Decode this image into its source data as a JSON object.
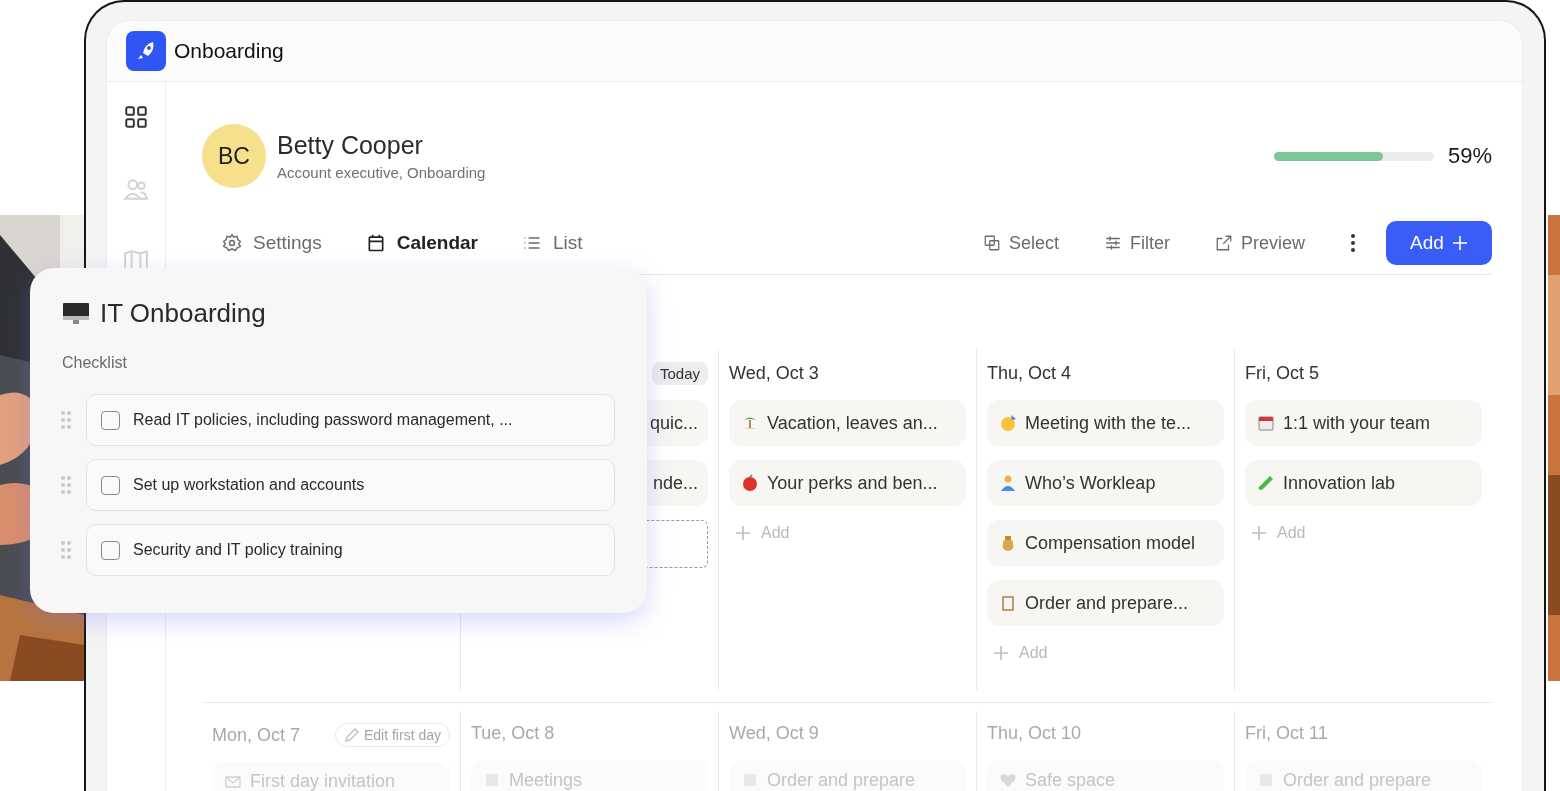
{
  "app": {
    "title": "Onboarding"
  },
  "sidebar": {
    "items": [
      {
        "kind": "grid",
        "selected": true
      },
      {
        "kind": "people",
        "selected": false
      },
      {
        "kind": "map",
        "selected": false
      }
    ]
  },
  "profile": {
    "initials": "BC",
    "name": "Betty Cooper",
    "subtitle": "Account executive, Onboarding",
    "progress": {
      "level": 0.68,
      "reading": "59%"
    }
  },
  "tabs": [
    {
      "label": "Settings",
      "kind": "settings",
      "selected": false
    },
    {
      "label": "Calendar",
      "kind": "calendar",
      "selected": true
    },
    {
      "label": "List",
      "kind": "list",
      "selected": false
    }
  ],
  "actions": [
    {
      "label": "Select",
      "kind": "select"
    },
    {
      "label": "Filter",
      "kind": "filter"
    },
    {
      "label": "Preview",
      "kind": "preview"
    }
  ],
  "add_button": {
    "label": "Add"
  },
  "week_1": {
    "days": [
      {
        "badge": "Today",
        "cards": [
          {
            "title": "quic..."
          },
          {
            "title": "nde..."
          }
        ],
        "drop_slot": true
      },
      {
        "label": "Wed, Oct 3",
        "cards": [
          {
            "kind": "palm",
            "title": "Vacation, leaves an..."
          },
          {
            "kind": "apple",
            "title": "Your perks and ben..."
          }
        ],
        "add_label": "Add"
      },
      {
        "label": "Thu, Oct 4",
        "cards": [
          {
            "kind": "party",
            "title": "Meeting with the te..."
          },
          {
            "kind": "person",
            "title": "Who’s Workleap"
          },
          {
            "kind": "money",
            "title": "Compensation model"
          },
          {
            "kind": "clipboard",
            "title": "Order and prepare..."
          }
        ],
        "add_label": "Add"
      },
      {
        "label": "Fri, Oct 5",
        "cards": [
          {
            "kind": "calendar",
            "title": "1:1 with your team"
          },
          {
            "kind": "tube",
            "title": "Innovation lab"
          }
        ],
        "add_label": "Add"
      }
    ]
  },
  "week_2": {
    "days": [
      {
        "label": "Mon, Oct 7",
        "chip": "Edit first day",
        "cards": [
          {
            "kind": "mail",
            "title": "First day invitation"
          }
        ]
      },
      {
        "label": "Tue, Oct 8",
        "cards": [
          {
            "kind": "note",
            "title": "Meetings"
          }
        ]
      },
      {
        "label": "Wed, Oct 9",
        "cards": [
          {
            "kind": "note",
            "title": "Order and prepare"
          }
        ]
      },
      {
        "label": "Thu, Oct 10",
        "cards": [
          {
            "kind": "heart",
            "title": "Safe space"
          }
        ]
      },
      {
        "label": "Fri, Oct 11",
        "cards": [
          {
            "kind": "note",
            "title": "Order and prepare"
          }
        ]
      }
    ]
  },
  "overlay": {
    "title": "IT Onboarding",
    "section": "Checklist",
    "items": [
      {
        "label": "Read IT policies, including password management, ...",
        "checked": false
      },
      {
        "label": "Set up workstation and accounts",
        "checked": false
      },
      {
        "label": "Security and IT policy training",
        "checked": false
      }
    ]
  }
}
